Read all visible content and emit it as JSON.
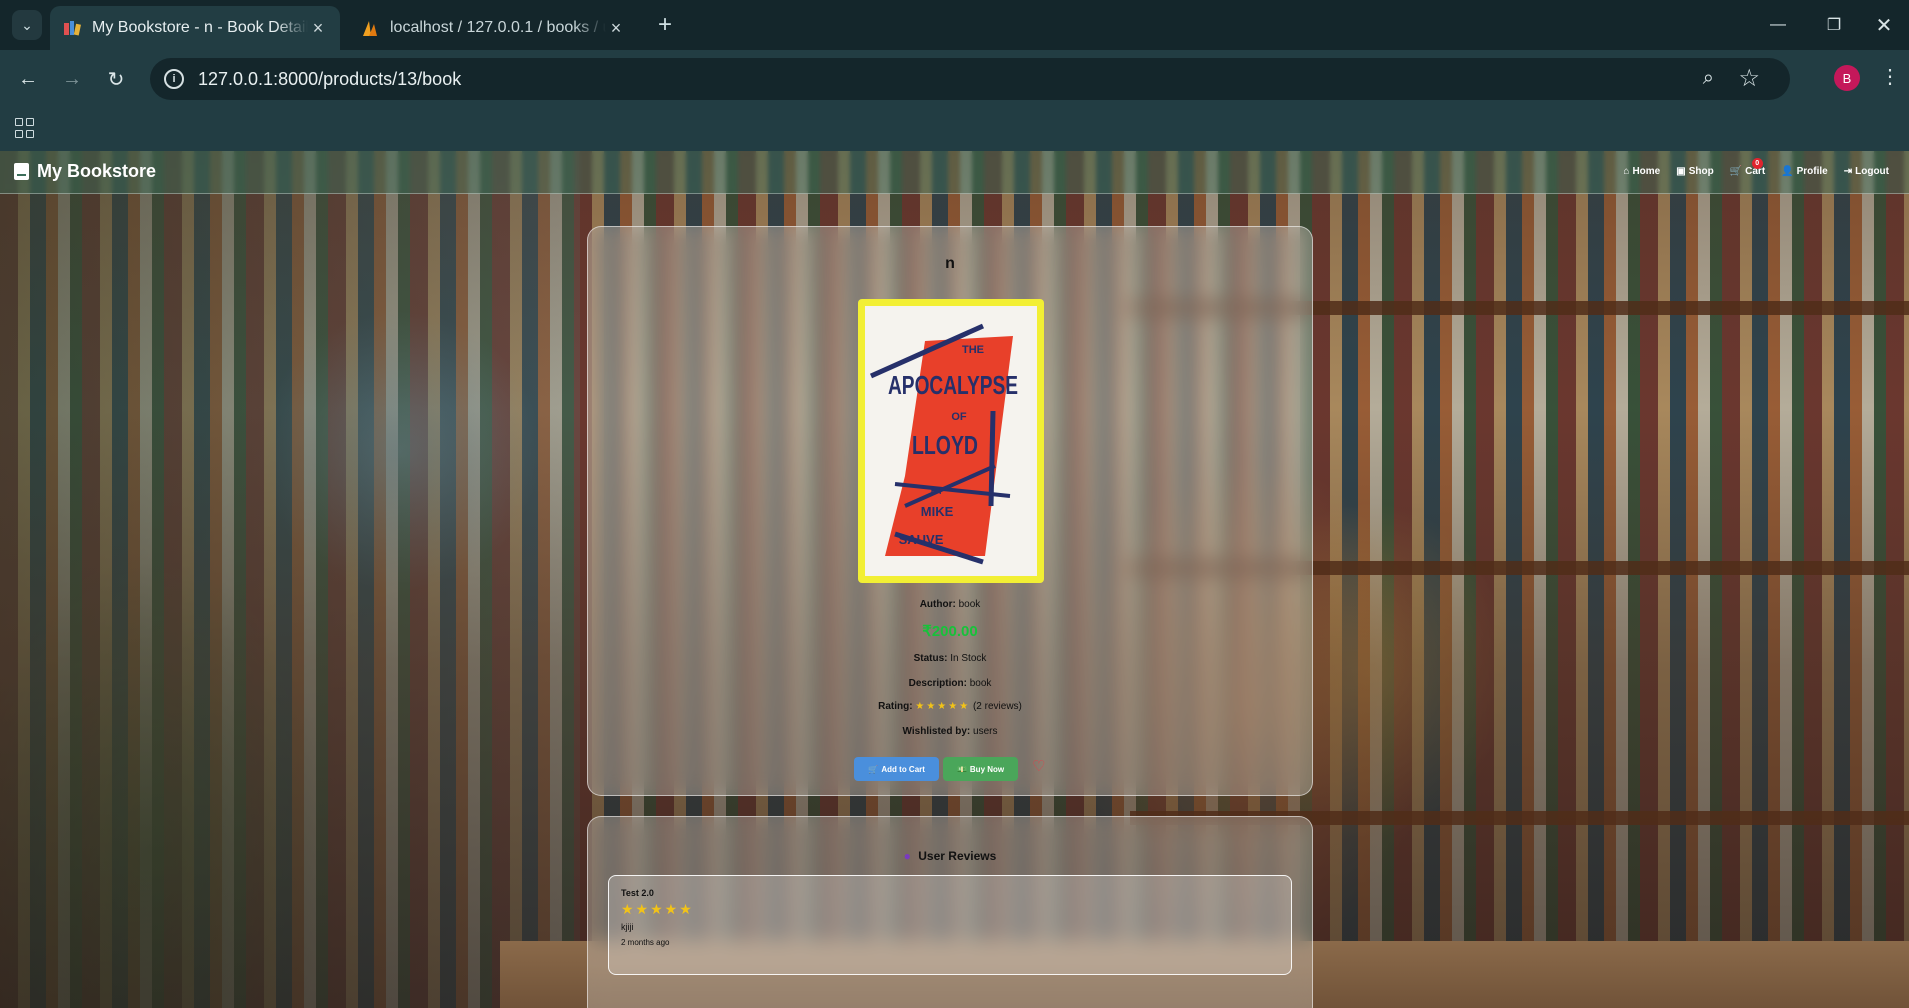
{
  "browser": {
    "tabs": [
      {
        "title": "My Bookstore - n - Book Details",
        "active": true
      },
      {
        "title": "localhost / 127.0.0.1 / books / users",
        "active": false
      }
    ],
    "url": "127.0.0.1:8000/products/13/book",
    "profile_initial": "B"
  },
  "site": {
    "brand": "My Bookstore",
    "nav": {
      "home": "Home",
      "shop": "Shop",
      "cart": "Cart",
      "cart_count": "0",
      "profile": "Profile",
      "logout": "Logout"
    }
  },
  "product": {
    "title": "n",
    "cover": {
      "line1": "THE",
      "line2": "APOCALYPSE",
      "line3": "OF",
      "line4": "LLOYD",
      "line5": "BY",
      "line6": "MIKE",
      "line7": "SAUVE"
    },
    "author_label": "Author:",
    "author": "book",
    "price": "₹200.00",
    "status_label": "Status:",
    "status": "In Stock",
    "description_label": "Description:",
    "description": "book",
    "rating_label": "Rating:",
    "rating_stars": "★★★★★",
    "rating_value": 5,
    "reviews_count": "(2 reviews)",
    "wishlisted_label": "Wishlisted by:",
    "wishlisted": "users",
    "add_to_cart": "Add to Cart",
    "buy_now": "Buy Now"
  },
  "reviews": {
    "heading": "User Reviews",
    "items": [
      {
        "name": "Test 2.0",
        "stars": "★★★★★",
        "rating": 5,
        "text": "kjiji",
        "date": "2 months ago"
      }
    ]
  },
  "colors": {
    "price": "#17c23a",
    "cart_button": "#4a8fdc",
    "buy_button": "#4aa65a",
    "star": "#f2c318",
    "cover_border": "#f2ef34"
  }
}
